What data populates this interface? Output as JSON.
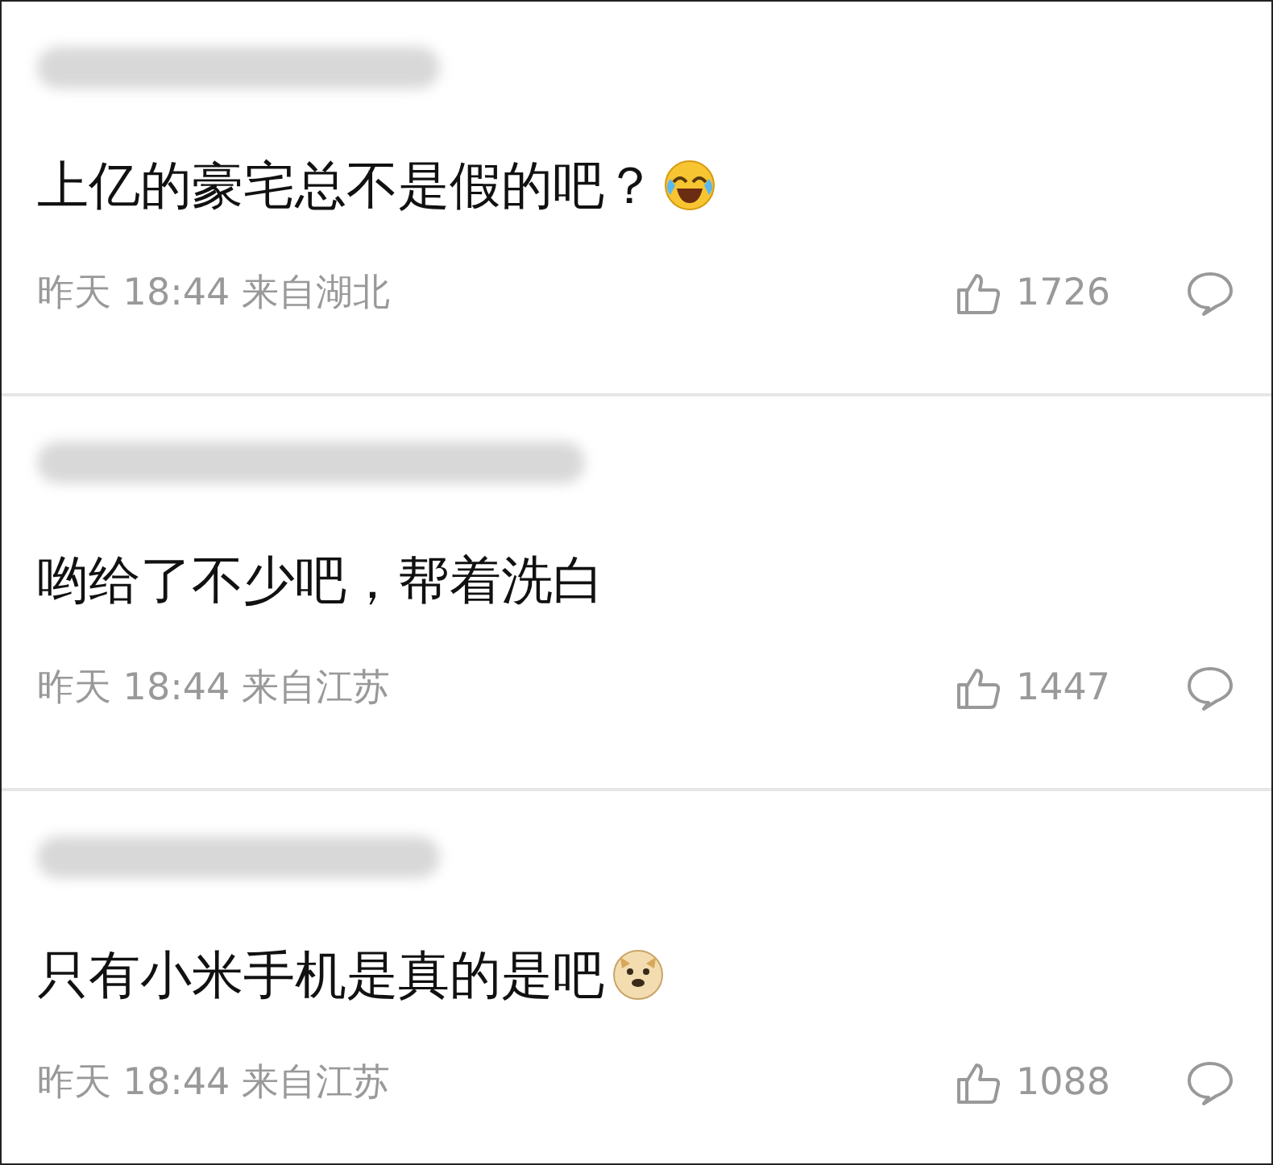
{
  "comments": [
    {
      "text": "上亿的豪宅总不是假的吧？",
      "emoji": {
        "kind": "laughing"
      },
      "time": "昨天 18:44",
      "location": "来自湖北",
      "likes": "1726"
    },
    {
      "text": "哟给了不少吧，帮着洗白",
      "time": "昨天 18:44",
      "location": "来自江苏",
      "likes": "1447"
    },
    {
      "text": "只有小米手机是真的是吧",
      "emoji": {
        "kind": "doge"
      },
      "time": "昨天 18:44",
      "location": "来自江苏",
      "likes": "1088"
    }
  ]
}
